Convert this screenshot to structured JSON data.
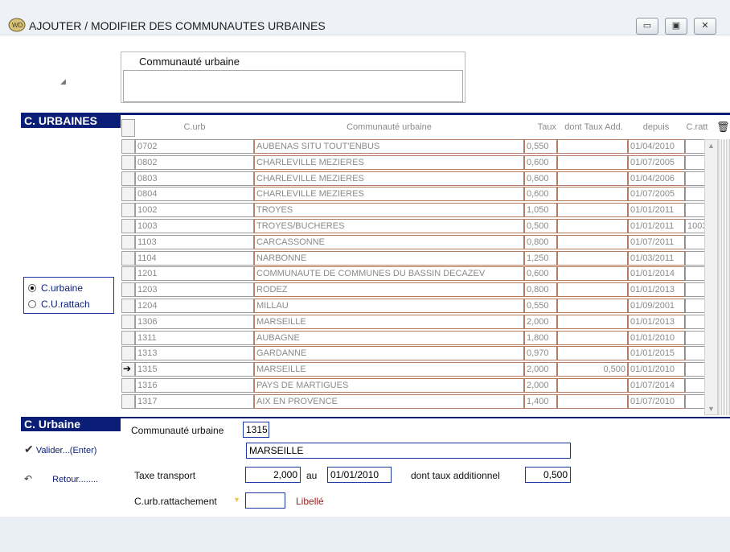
{
  "window": {
    "title": "AJOUTER / MODIFIER DES COMMUNAUTES URBAINES",
    "minimize_icon": "minimize-icon",
    "restore_icon": "restore-icon",
    "close_icon": "close-icon"
  },
  "search": {
    "label": "Communauté urbaine",
    "value": ""
  },
  "section_top": {
    "title": "C. URBAINES"
  },
  "grid": {
    "headers": [
      "C.urb",
      "Communauté urbaine",
      "Taux",
      "dont Taux Add.",
      "depuis",
      "C.ratt"
    ],
    "rows": [
      {
        "code": "0702",
        "name": "AUBENAS SITU TOUT'ENBUS",
        "taux": "0,550",
        "add": "",
        "depuis": "01/04/2010",
        "ratt": ""
      },
      {
        "code": "0802",
        "name": "CHARLEVILLE MEZIERES",
        "taux": "0,600",
        "add": "",
        "depuis": "01/07/2005",
        "ratt": ""
      },
      {
        "code": "0803",
        "name": "CHARLEVILLE MEZIERES",
        "taux": "0,600",
        "add": "",
        "depuis": "01/04/2006",
        "ratt": ""
      },
      {
        "code": "0804",
        "name": "CHARLEVILLE MEZIERES",
        "taux": "0,600",
        "add": "",
        "depuis": "01/07/2005",
        "ratt": ""
      },
      {
        "code": "1002",
        "name": "TROYES",
        "taux": "1,050",
        "add": "",
        "depuis": "01/01/2011",
        "ratt": ""
      },
      {
        "code": "1003",
        "name": "TROYES/BUCHERES",
        "taux": "0,500",
        "add": "",
        "depuis": "01/01/2011",
        "ratt": "1003"
      },
      {
        "code": "1103",
        "name": "CARCASSONNE",
        "taux": "0,800",
        "add": "",
        "depuis": "01/07/2011",
        "ratt": ""
      },
      {
        "code": "1104",
        "name": "NARBONNE",
        "taux": "1,250",
        "add": "",
        "depuis": "01/03/2011",
        "ratt": ""
      },
      {
        "code": "1201",
        "name": "COMMUNAUTE DE COMMUNES DU BASSIN DECAZEV",
        "taux": "0,600",
        "add": "",
        "depuis": "01/01/2014",
        "ratt": ""
      },
      {
        "code": "1203",
        "name": "RODEZ",
        "taux": "0,800",
        "add": "",
        "depuis": "01/01/2013",
        "ratt": ""
      },
      {
        "code": "1204",
        "name": "MILLAU",
        "taux": "0,550",
        "add": "",
        "depuis": "01/09/2001",
        "ratt": ""
      },
      {
        "code": "1306",
        "name": "MARSEILLE",
        "taux": "2,000",
        "add": "",
        "depuis": "01/01/2013",
        "ratt": ""
      },
      {
        "code": "1311",
        "name": "AUBAGNE",
        "taux": "1,800",
        "add": "",
        "depuis": "01/01/2010",
        "ratt": ""
      },
      {
        "code": "1313",
        "name": "GARDANNE",
        "taux": "0,970",
        "add": "",
        "depuis": "01/01/2015",
        "ratt": ""
      },
      {
        "code": "1315",
        "name": "MARSEILLE",
        "taux": "2,000",
        "add": "0,500",
        "depuis": "01/01/2010",
        "ratt": "",
        "selected": true
      },
      {
        "code": "1316",
        "name": "PAYS DE MARTIGUES",
        "taux": "2,000",
        "add": "",
        "depuis": "01/07/2014",
        "ratt": ""
      },
      {
        "code": "1317",
        "name": "AIX EN PROVENCE",
        "taux": "1,400",
        "add": "",
        "depuis": "01/07/2010",
        "ratt": ""
      }
    ]
  },
  "radio": {
    "options": [
      "C.urbaine",
      "C.U.rattach"
    ],
    "selected": "C.urbaine"
  },
  "bottom": {
    "title": "C. Urbaine",
    "validate_label": "Valider...(Enter)",
    "return_label": "Retour........",
    "check_icon": "check-icon",
    "return_icon": "undo-icon"
  },
  "form": {
    "code_label": "Communauté urbaine",
    "code_value": "1315",
    "name_value": "MARSEILLE",
    "taxe_label": "Taxe transport",
    "taxe_value": "2,000",
    "au_label": "au",
    "date_value": "01/01/2010",
    "dont_label": "dont taux additionnel",
    "dont_value": "0,500",
    "ratt_label": "C.urb.rattachement",
    "ratt_value": "",
    "libelle_label": "Libellé"
  }
}
